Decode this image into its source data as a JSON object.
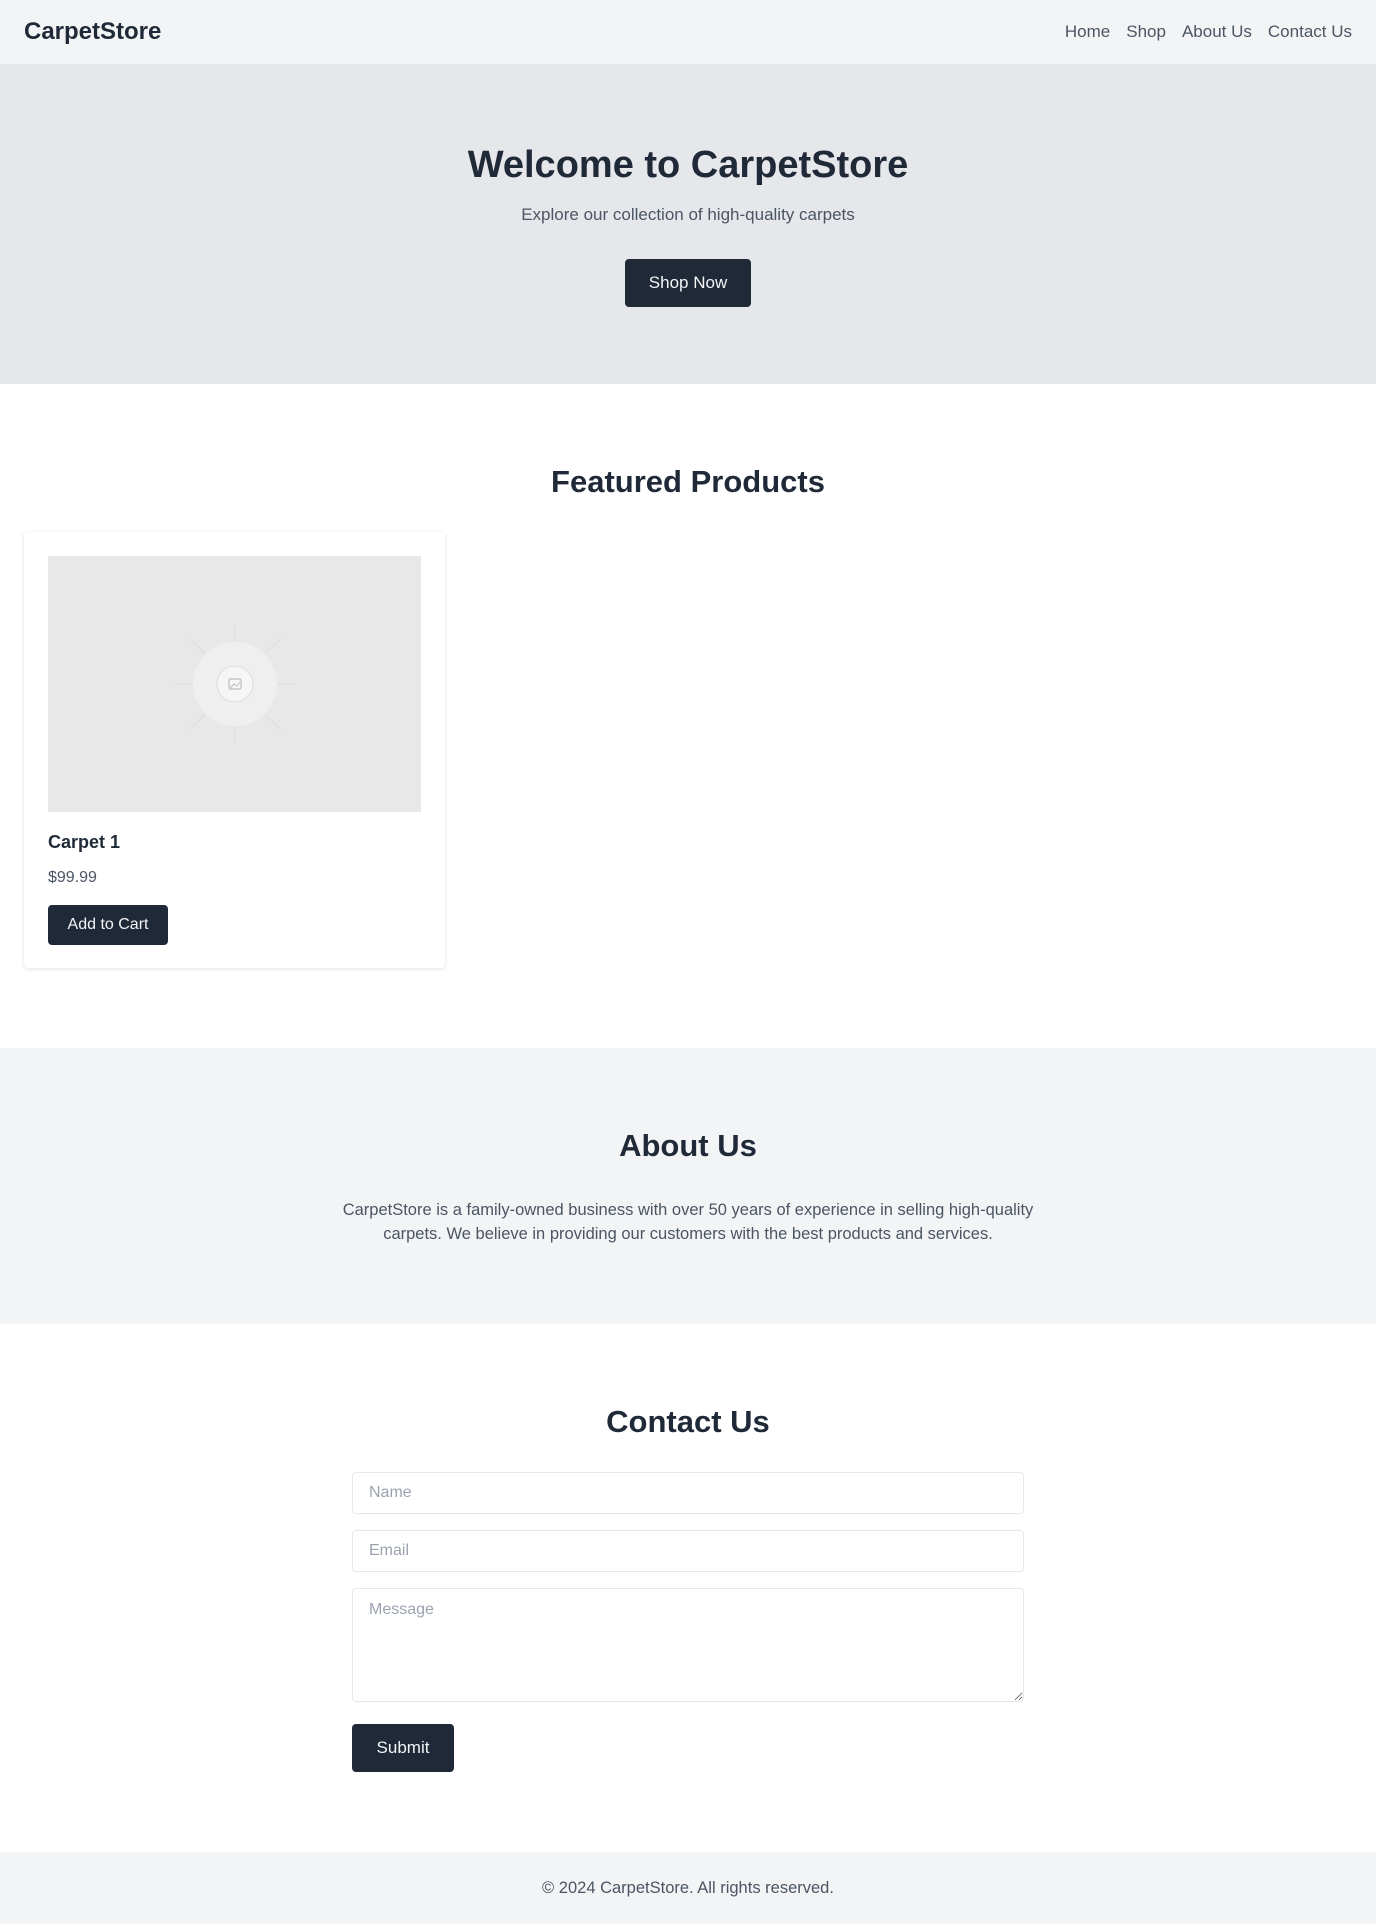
{
  "header": {
    "brand": "CarpetStore",
    "nav": [
      "Home",
      "Shop",
      "About Us",
      "Contact Us"
    ]
  },
  "hero": {
    "title": "Welcome to CarpetStore",
    "subtitle": "Explore our collection of high-quality carpets",
    "cta_label": "Shop Now"
  },
  "featured": {
    "title": "Featured Products",
    "products": [
      {
        "name": "Carpet 1",
        "price": "$99.99",
        "cart_label": "Add to Cart"
      }
    ]
  },
  "about": {
    "title": "About Us",
    "text": "CarpetStore is a family-owned business with over 50 years of experience in selling high-quality carpets. We believe in providing our customers with the best products and services."
  },
  "contact": {
    "title": "Contact Us",
    "name_placeholder": "Name",
    "email_placeholder": "Email",
    "message_placeholder": "Message",
    "submit_label": "Submit"
  },
  "footer": {
    "text": "© 2024 CarpetStore. All rights reserved."
  },
  "colors": {
    "primary": "#1f2937",
    "muted_text": "#4b5563",
    "light_bg": "#f3f4f6",
    "hero_bg": "#e5e7eb"
  },
  "icons": {
    "product_image": "image-placeholder-icon"
  }
}
